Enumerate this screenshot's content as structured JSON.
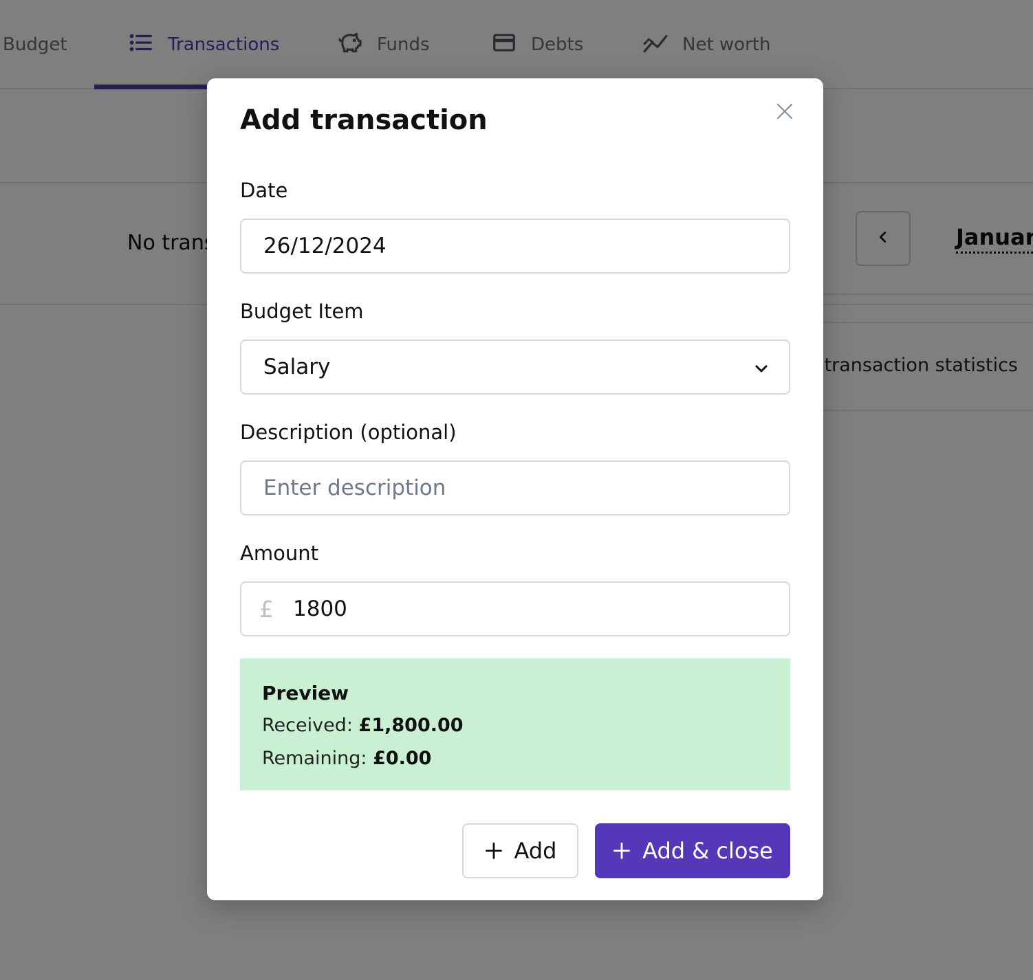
{
  "nav": {
    "tabs": [
      {
        "label": "Budget",
        "icon": "budget-icon"
      },
      {
        "label": "Transactions",
        "icon": "list-icon",
        "active": true
      },
      {
        "label": "Funds",
        "icon": "piggy-bank-icon"
      },
      {
        "label": "Debts",
        "icon": "credit-card-icon"
      },
      {
        "label": "Net worth",
        "icon": "trend-chart-icon"
      }
    ]
  },
  "page": {
    "no_transactions_text": "No trans",
    "month": "January",
    "stats_text": "e transaction statistics"
  },
  "modal": {
    "title": "Add transaction",
    "date": {
      "label": "Date",
      "value": "26/12/2024"
    },
    "budget_item": {
      "label": "Budget Item",
      "value": "Salary"
    },
    "description": {
      "label": "Description (optional)",
      "placeholder": "Enter description",
      "value": ""
    },
    "amount": {
      "label": "Amount",
      "currency": "£",
      "value": "1800"
    },
    "preview": {
      "title": "Preview",
      "received_label": "Received:",
      "received_value": "£1,800.00",
      "remaining_label": "Remaining:",
      "remaining_value": "£0.00",
      "background": "#c9f0d2"
    },
    "buttons": {
      "add_label": "Add",
      "add_close_label": "Add & close"
    }
  },
  "colors": {
    "accent": "#5538b8",
    "nav_active": "#4c3bb5"
  }
}
